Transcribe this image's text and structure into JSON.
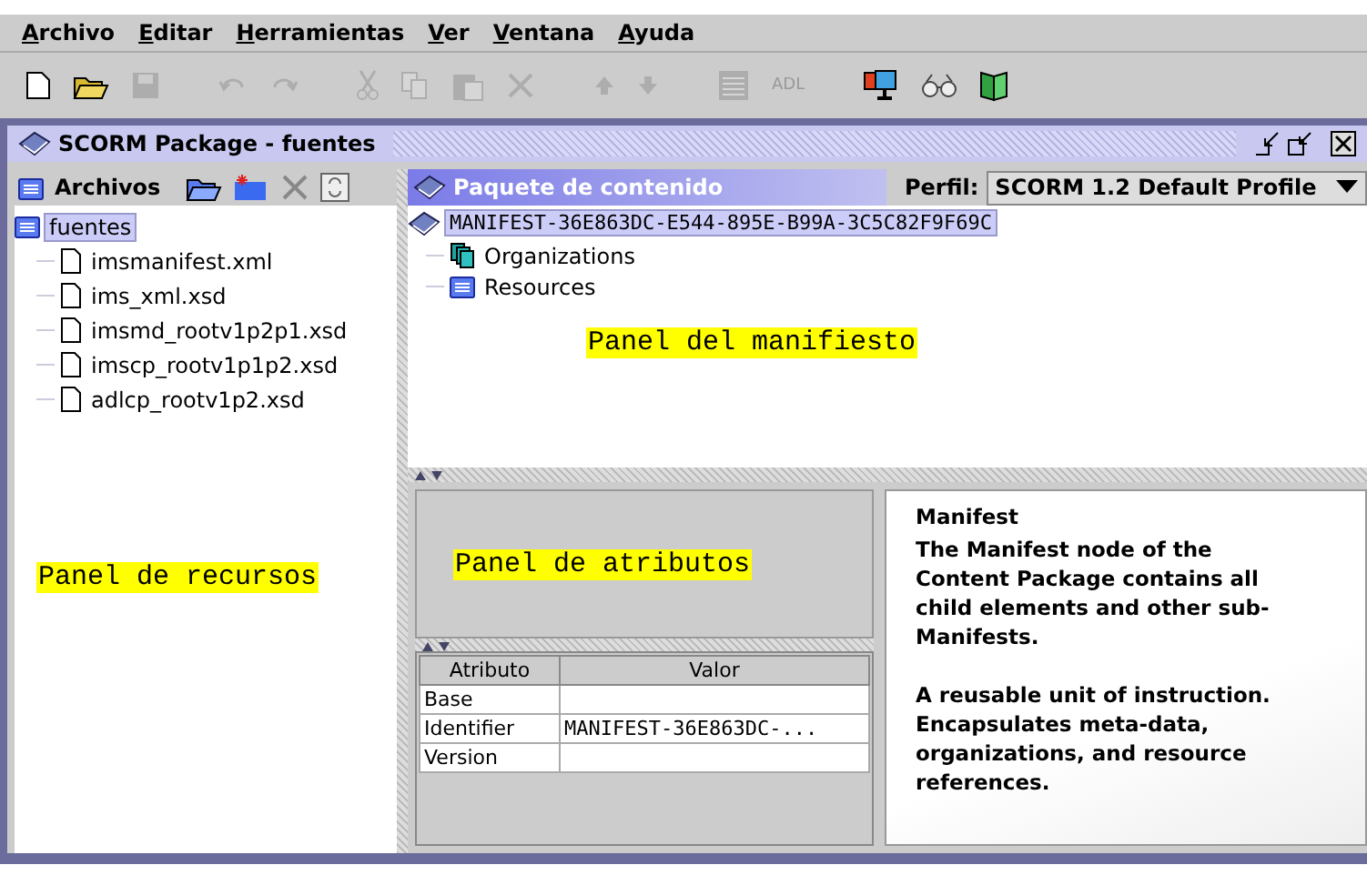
{
  "menu": [
    "Archivo",
    "Editar",
    "Herramientas",
    "Ver",
    "Ventana",
    "Ayuda"
  ],
  "toolbar": [
    {
      "kind": "new",
      "disabled": false
    },
    {
      "kind": "open",
      "disabled": false
    },
    {
      "kind": "save",
      "disabled": true
    },
    {
      "kind": "undo",
      "disabled": true
    },
    {
      "kind": "redo",
      "disabled": true
    },
    {
      "kind": "cut",
      "disabled": true
    },
    {
      "kind": "copy",
      "disabled": true
    },
    {
      "kind": "paste",
      "disabled": true
    },
    {
      "kind": "delete",
      "disabled": true
    },
    {
      "kind": "up",
      "disabled": true
    },
    {
      "kind": "down",
      "disabled": true
    },
    {
      "kind": "list",
      "disabled": true
    },
    {
      "kind": "text",
      "label": "ADL",
      "disabled": true
    },
    {
      "kind": "monitor",
      "disabled": false
    },
    {
      "kind": "binoculars",
      "disabled": false
    },
    {
      "kind": "book",
      "disabled": false
    }
  ],
  "window": {
    "title": "SCORM Package - fuentes"
  },
  "files_panel": {
    "title": "Archivos",
    "tree": {
      "label": "fuentes",
      "selected": true,
      "children": [
        {
          "label": "imsmanifest.xml",
          "selected": false
        },
        {
          "label": "ims_xml.xsd",
          "selected": false
        },
        {
          "label": "imsmd_rootv1p2p1.xsd",
          "selected": false
        },
        {
          "label": "imscp_rootv1p1p2.xsd",
          "selected": false
        },
        {
          "label": "adlcp_rootv1p2.xsd",
          "selected": false
        }
      ]
    },
    "annotation": "Panel de recursos"
  },
  "package_panel": {
    "title": "Paquete de contenido",
    "profile_label": "Perfil:",
    "profile_value": "SCORM 1.2 Default Profile",
    "tree": {
      "label": "MANIFEST-36E863DC-E544-895E-B99A-3C5C82F9F69C",
      "kind": "manifest",
      "selected": true,
      "children": [
        {
          "label": "Organizations",
          "kind": "organizations",
          "selected": false
        },
        {
          "label": "Resources",
          "kind": "resources",
          "selected": false
        }
      ]
    },
    "annotation": "Panel del manifiesto"
  },
  "attributes_panel": {
    "annotation": "Panel de atributos",
    "columns": [
      "Atributo",
      "Valor"
    ],
    "rows": [
      [
        "Base",
        ""
      ],
      [
        "Identifier",
        "MANIFEST-36E863DC-..."
      ],
      [
        "Version",
        ""
      ]
    ]
  },
  "description": {
    "title": "Manifest",
    "paragraphs": [
      "The Manifest node of the Content Package contains all child elements and other sub-Manifests.",
      "A reusable unit of instruction. Encapsulates meta-data, organizations, and resource references."
    ]
  }
}
